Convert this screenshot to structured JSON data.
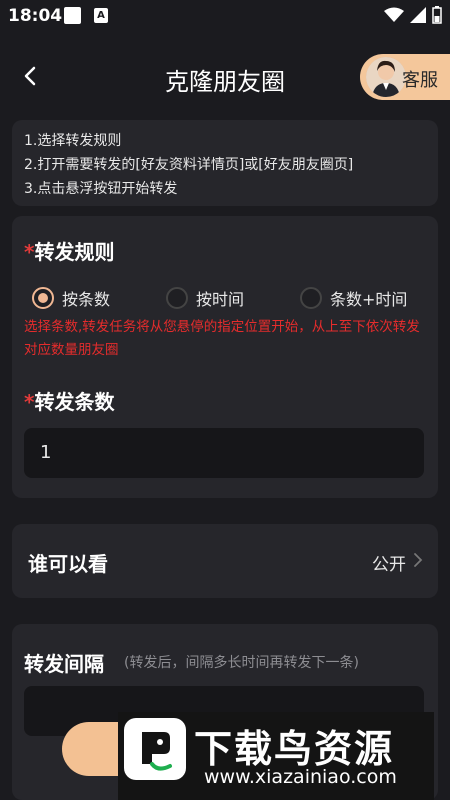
{
  "status_bar": {
    "time": "18:04",
    "notif_icon_2": "A"
  },
  "header": {
    "title": "克隆朋友圈",
    "service_label": "客服"
  },
  "rules": {
    "lines": [
      "1.选择转发规则",
      "2.打开需要转发的[好友资料详情页]或[好友朋友圈页]",
      "3.点击悬浮按钮开始转发"
    ]
  },
  "forward_rule": {
    "required_mark": "*",
    "title": "转发规则",
    "options": [
      "按条数",
      "按时间",
      "条数+时间"
    ],
    "selected_index": 0,
    "hint": "选择条数,转发任务将从您悬停的指定位置开始，从上至下依次转发对应数量朋友圈"
  },
  "forward_count": {
    "required_mark": "*",
    "title": "转发条数",
    "value": "1"
  },
  "visibility": {
    "label": "谁可以看",
    "value": "公开"
  },
  "interval": {
    "label": "转发间隔",
    "hint": "(转发后，间隔多长时间再转发下一条)"
  },
  "watermark": {
    "name": "下载鸟资源",
    "url": "www.xiazainiao.com"
  },
  "colors": {
    "background": "#1b1b1f",
    "card": "#26262b",
    "accent": "#f0b793",
    "warning": "#e52c2c"
  }
}
